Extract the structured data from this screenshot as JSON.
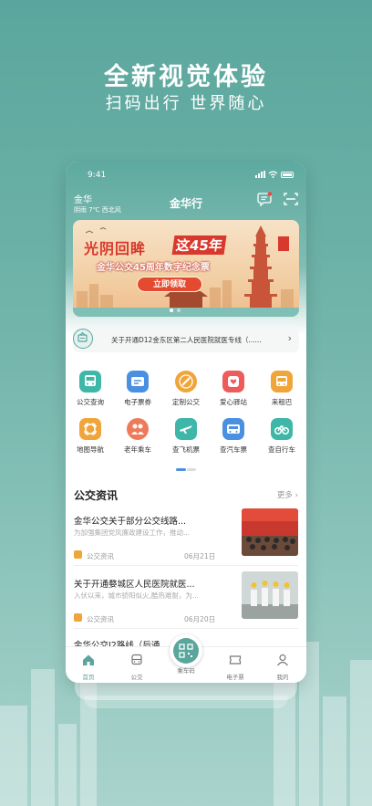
{
  "promo": {
    "title": "全新视觉体验",
    "subtitle": "扫码出行 世界随心"
  },
  "status_bar": {
    "time": "9:41"
  },
  "header": {
    "city": "金华",
    "weather": "阴雨  7℃  西北风",
    "app_title": "金华行"
  },
  "banner": {
    "headline_a": "光阴回眸",
    "headline_b": "这45年",
    "subline": "金华公交45周年数字纪念票",
    "button": "立即领取"
  },
  "notice": {
    "text": "关于开通D12金东区第二人民医院就医专线（......"
  },
  "services": [
    {
      "label": "公交查询",
      "icon": "bus-icon",
      "color": "#3fb7a8"
    },
    {
      "label": "电子票券",
      "icon": "ticket-icon",
      "color": "#4a90e2"
    },
    {
      "label": "定制公交",
      "icon": "custom-bus-icon",
      "color": "#f0a53a"
    },
    {
      "label": "爱心驿站",
      "icon": "heart-station-icon",
      "color": "#ef5a5a"
    },
    {
      "label": "来租巴",
      "icon": "rent-bus-icon",
      "color": "#f0a53a"
    },
    {
      "label": "地图导航",
      "icon": "map-icon",
      "color": "#f0a53a"
    },
    {
      "label": "老年乘车",
      "icon": "elderly-icon",
      "color": "#ef7a5a"
    },
    {
      "label": "查飞机票",
      "icon": "plane-icon",
      "color": "#3fb7a8"
    },
    {
      "label": "查汽车票",
      "icon": "coach-icon",
      "color": "#4a90e2"
    },
    {
      "label": "查自行车",
      "icon": "bike-icon",
      "color": "#3fb7a8"
    }
  ],
  "news_section": {
    "title": "公交资讯",
    "more": "更多"
  },
  "news": [
    {
      "title": "金华公交关于部分公交线路...",
      "summary": "为加强集团党风廉政建设工作，推动...",
      "source": "公交资讯",
      "date": "06月21日"
    },
    {
      "title": "关于开通婺城区人民医院就医...",
      "summary": "入伏以来，城市骄阳似火,酷热难耐，为...",
      "source": "公交资讯",
      "date": "06月20日"
    },
    {
      "title": "金华公交J2路线（后通..."
    }
  ],
  "tabs": [
    {
      "label": "首页",
      "icon": "home-icon"
    },
    {
      "label": "公交",
      "icon": "bus-tab-icon"
    },
    {
      "label": "乘车码",
      "icon": "qr-code-icon"
    },
    {
      "label": "电子票",
      "icon": "e-ticket-icon"
    },
    {
      "label": "我的",
      "icon": "profile-icon"
    }
  ],
  "colors": {
    "brand": "#5aa69d",
    "accent_red": "#d9382c"
  }
}
